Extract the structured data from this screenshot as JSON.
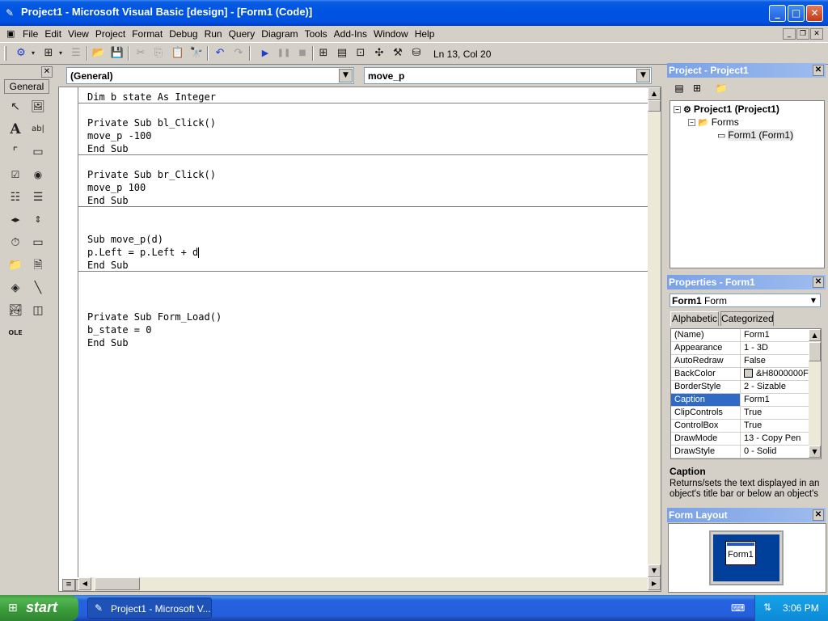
{
  "window": {
    "title": "Project1 - Microsoft Visual Basic [design] - [Form1 (Code)]",
    "controls": {
      "minimize": "_",
      "maximize": "□",
      "close": "✕"
    }
  },
  "menubar": {
    "items": [
      "File",
      "Edit",
      "View",
      "Project",
      "Format",
      "Debug",
      "Run",
      "Query",
      "Diagram",
      "Tools",
      "Add-Ins",
      "Window",
      "Help"
    ]
  },
  "toolbar": {
    "cursor_position": "Ln 13, Col 20"
  },
  "toolbox": {
    "tab_label": "General"
  },
  "code_window": {
    "object_combo": "(General)",
    "procedure_combo": "move_p",
    "lines": [
      "Dim b state As Integer",
      "Private Sub bl_Click()",
      "move_p -100",
      "End Sub",
      "Private Sub br_Click()",
      "move_p 100",
      "End Sub",
      "Sub move_p(d)",
      "p.Left = p.Left + d",
      "End Sub",
      "Private Sub Form_Load()",
      "b_state = 0",
      "End Sub"
    ]
  },
  "project_panel": {
    "title": "Project - Project1",
    "tree": {
      "project": "Project1 (Project1)",
      "folder": "Forms",
      "form": "Form1 (Form1)"
    }
  },
  "properties_panel": {
    "title": "Properties - Form1",
    "object_name": "Form1",
    "object_type": "Form",
    "tabs": [
      "Alphabetic",
      "Categorized"
    ],
    "rows": [
      {
        "name": "(Name)",
        "value": "Form1"
      },
      {
        "name": "Appearance",
        "value": "1 - 3D"
      },
      {
        "name": "AutoRedraw",
        "value": "False"
      },
      {
        "name": "BackColor",
        "value": "&H8000000F"
      },
      {
        "name": "BorderStyle",
        "value": "2 - Sizable"
      },
      {
        "name": "Caption",
        "value": "Form1"
      },
      {
        "name": "ClipControls",
        "value": "True"
      },
      {
        "name": "ControlBox",
        "value": "True"
      },
      {
        "name": "DrawMode",
        "value": "13 - Copy Pen"
      },
      {
        "name": "DrawStyle",
        "value": "0 - Solid"
      }
    ],
    "selected_property": "Caption",
    "description_name": "Caption",
    "description_text": "Returns/sets the text displayed in an object's title bar or below an object's"
  },
  "form_layout_panel": {
    "title": "Form Layout",
    "form_label": "Form1"
  },
  "taskbar": {
    "start_label": "start",
    "task_label": "Project1 - Microsoft V...",
    "clock": "3:06 PM"
  },
  "colors": {
    "selection": "#316ac5",
    "titlebar": "#0054e3",
    "panel_header": "#7aa1e6"
  }
}
